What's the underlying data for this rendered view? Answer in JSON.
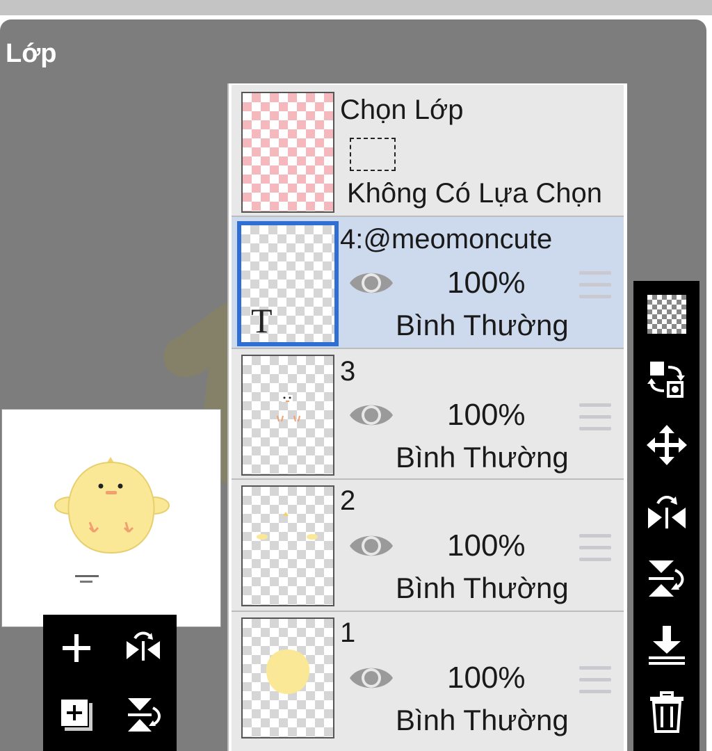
{
  "panel": {
    "title": "Lớp"
  },
  "selection_layer": {
    "title": "Chọn Lớp",
    "status": "Không Có Lựa Chọn"
  },
  "layers": [
    {
      "name": "4:@meomoncute",
      "opacity": "100%",
      "blend": "Bình Thường",
      "selected": true,
      "type": "text",
      "thumb_glyph": "T"
    },
    {
      "name": "3",
      "opacity": "100%",
      "blend": "Bình Thường",
      "selected": false
    },
    {
      "name": "2",
      "opacity": "100%",
      "blend": "Bình Thường",
      "selected": false
    },
    {
      "name": "1",
      "opacity": "100%",
      "blend": "Bình Thường",
      "selected": false
    }
  ],
  "bottom_tools": [
    "add-layer-icon",
    "flip-horizontal-icon",
    "duplicate-layer-icon",
    "flip-vertical-icon"
  ],
  "right_tools": [
    "transparency-checker-icon",
    "swap-layers-icon",
    "move-icon",
    "flip-horizontal-icon",
    "flip-vertical-icon",
    "merge-down-icon",
    "trash-icon"
  ],
  "colors": {
    "panel_bg": "#7d7d7d",
    "selected_row": "#cdd9ec",
    "selected_border": "#2f6fd4",
    "chick_yellow": "#fbe896",
    "chick_feet": "#f0a070"
  }
}
